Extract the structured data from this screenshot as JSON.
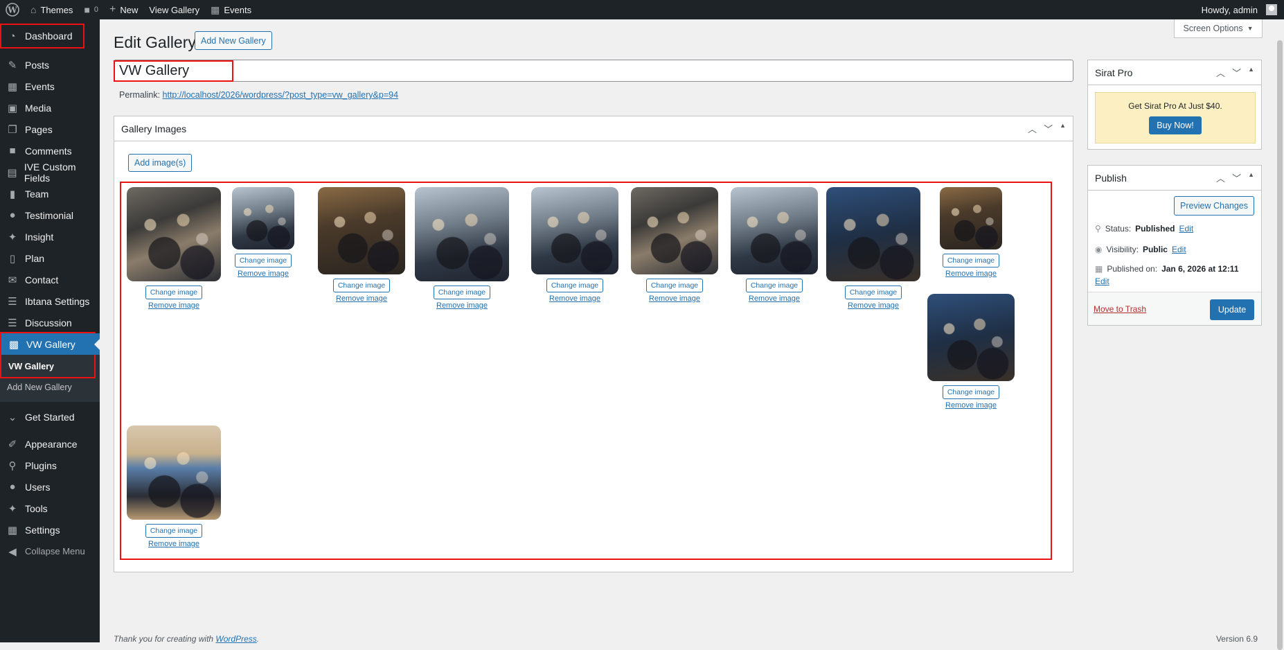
{
  "adminbar": {
    "site_name": "Themes",
    "comments_count": "0",
    "new_label": "New",
    "view_gallery": "View Gallery",
    "events": "Events",
    "howdy": "Howdy, admin"
  },
  "sidebar": {
    "items": [
      {
        "label": "Dashboard",
        "icon": "gauge-icon"
      },
      {
        "label": "Posts",
        "icon": "pin-icon"
      },
      {
        "label": "Events",
        "icon": "calendar-icon"
      },
      {
        "label": "Media",
        "icon": "media-icon"
      },
      {
        "label": "Pages",
        "icon": "pages-icon"
      },
      {
        "label": "Comments",
        "icon": "comment-icon"
      },
      {
        "label": "IVE Custom Fields",
        "icon": "grid-icon"
      },
      {
        "label": "Team",
        "icon": "book-icon"
      },
      {
        "label": "Testimonial",
        "icon": "person-icon"
      },
      {
        "label": "Insight",
        "icon": "wrench-icon"
      },
      {
        "label": "Plan",
        "icon": "document-icon"
      },
      {
        "label": "Contact",
        "icon": "mail-icon"
      },
      {
        "label": "Ibtana Settings",
        "icon": "list-icon"
      },
      {
        "label": "Discussion",
        "icon": "list-icon"
      },
      {
        "label": "VW Gallery",
        "icon": "gallery-icon"
      }
    ],
    "gallery_sub": [
      "VW Gallery",
      "Add New Gallery"
    ],
    "items_after": [
      {
        "label": "Get Started",
        "icon": "chevron-icon"
      },
      {
        "label": "Appearance",
        "icon": "brush-icon"
      },
      {
        "label": "Plugins",
        "icon": "plug-icon"
      },
      {
        "label": "Users",
        "icon": "users-icon"
      },
      {
        "label": "Tools",
        "icon": "tools-icon"
      },
      {
        "label": "Settings",
        "icon": "settings-icon"
      }
    ],
    "collapse": "Collapse Menu"
  },
  "main": {
    "title": "Edit Gallery",
    "add_new": "Add New Gallery",
    "screen_options": "Screen Options",
    "post_title": "VW Gallery",
    "permalink_label": "Permalink:",
    "permalink_url": "http://localhost/2026/wordpress/?post_type=vw_gallery&p=94"
  },
  "gallery": {
    "header": "Gallery Images",
    "add_images": "Add image(s)",
    "change_label": "Change image",
    "remove_label": "Remove image"
  },
  "sirat": {
    "header": "Sirat Pro",
    "promo": "Get Sirat Pro At Just $40.",
    "buy": "Buy Now!"
  },
  "publish": {
    "header": "Publish",
    "preview": "Preview Changes",
    "status_label": "Status:",
    "status_value": "Published",
    "visibility_label": "Visibility:",
    "visibility_value": "Public",
    "published_label": "Published on:",
    "published_value": "Jan 6, 2026 at 12:11",
    "edit": "Edit",
    "trash": "Move to Trash",
    "update": "Update"
  },
  "footer": {
    "thanks": "Thank you for creating with",
    "wordpress": "WordPress",
    "version": "Version 6.9"
  }
}
